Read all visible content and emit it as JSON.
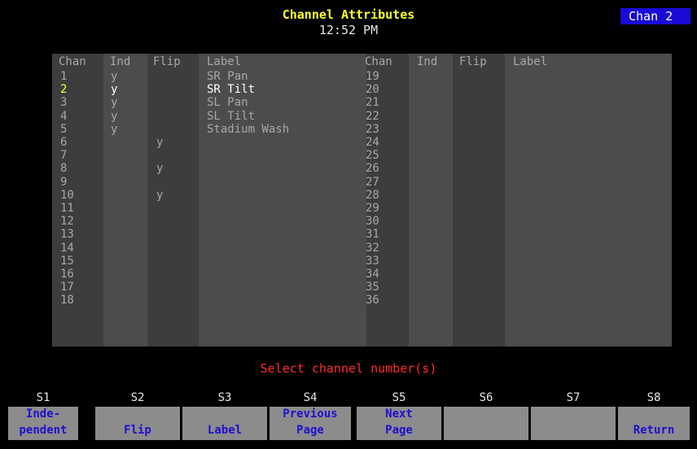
{
  "header": {
    "title": "Channel Attributes",
    "time": "12:52 PM",
    "channel_badge": "Chan 2"
  },
  "table": {
    "headers": {
      "chan": "Chan",
      "ind": "Ind",
      "flip": "Flip",
      "label": "Label"
    },
    "rows": [
      {
        "chan": "1",
        "ind": "y",
        "flip": "",
        "label": "SR Pan"
      },
      {
        "chan": "2",
        "ind": "y",
        "flip": "",
        "label": "SR Tilt",
        "selected": true
      },
      {
        "chan": "3",
        "ind": "y",
        "flip": "",
        "label": "SL Pan"
      },
      {
        "chan": "4",
        "ind": "y",
        "flip": "",
        "label": "SL Tilt"
      },
      {
        "chan": "5",
        "ind": "y",
        "flip": "",
        "label": "Stadium Wash"
      },
      {
        "chan": "6",
        "ind": "",
        "flip": "y",
        "label": ""
      },
      {
        "chan": "7",
        "ind": "",
        "flip": "",
        "label": ""
      },
      {
        "chan": "8",
        "ind": "",
        "flip": "y",
        "label": ""
      },
      {
        "chan": "9",
        "ind": "",
        "flip": "",
        "label": ""
      },
      {
        "chan": "10",
        "ind": "",
        "flip": "y",
        "label": ""
      },
      {
        "chan": "11",
        "ind": "",
        "flip": "",
        "label": ""
      },
      {
        "chan": "12",
        "ind": "",
        "flip": "",
        "label": ""
      },
      {
        "chan": "13",
        "ind": "",
        "flip": "",
        "label": ""
      },
      {
        "chan": "14",
        "ind": "",
        "flip": "",
        "label": ""
      },
      {
        "chan": "15",
        "ind": "",
        "flip": "",
        "label": ""
      },
      {
        "chan": "16",
        "ind": "",
        "flip": "",
        "label": ""
      },
      {
        "chan": "17",
        "ind": "",
        "flip": "",
        "label": ""
      },
      {
        "chan": "18",
        "ind": "",
        "flip": "",
        "label": ""
      },
      {
        "chan": "19",
        "ind": "",
        "flip": "",
        "label": ""
      },
      {
        "chan": "20",
        "ind": "",
        "flip": "",
        "label": ""
      },
      {
        "chan": "21",
        "ind": "",
        "flip": "",
        "label": ""
      },
      {
        "chan": "22",
        "ind": "",
        "flip": "",
        "label": ""
      },
      {
        "chan": "23",
        "ind": "",
        "flip": "",
        "label": ""
      },
      {
        "chan": "24",
        "ind": "",
        "flip": "",
        "label": ""
      },
      {
        "chan": "25",
        "ind": "",
        "flip": "",
        "label": ""
      },
      {
        "chan": "26",
        "ind": "",
        "flip": "",
        "label": ""
      },
      {
        "chan": "27",
        "ind": "",
        "flip": "",
        "label": ""
      },
      {
        "chan": "28",
        "ind": "",
        "flip": "",
        "label": ""
      },
      {
        "chan": "29",
        "ind": "",
        "flip": "",
        "label": ""
      },
      {
        "chan": "30",
        "ind": "",
        "flip": "",
        "label": ""
      },
      {
        "chan": "31",
        "ind": "",
        "flip": "",
        "label": ""
      },
      {
        "chan": "32",
        "ind": "",
        "flip": "",
        "label": ""
      },
      {
        "chan": "33",
        "ind": "",
        "flip": "",
        "label": ""
      },
      {
        "chan": "34",
        "ind": "",
        "flip": "",
        "label": ""
      },
      {
        "chan": "35",
        "ind": "",
        "flip": "",
        "label": ""
      },
      {
        "chan": "36",
        "ind": "",
        "flip": "",
        "label": ""
      }
    ]
  },
  "prompt": "Select channel number(s)",
  "softkeys": [
    {
      "num": "S1",
      "line1": "Inde-",
      "line2": "pendent"
    },
    {
      "num": "S2",
      "line1": "",
      "line2": "Flip"
    },
    {
      "num": "S3",
      "line1": "",
      "line2": "Label"
    },
    {
      "num": "S4",
      "line1": "Previous",
      "line2": "Page"
    },
    {
      "num": "S5",
      "line1": "Next",
      "line2": "Page"
    },
    {
      "num": "S6",
      "line1": "",
      "line2": ""
    },
    {
      "num": "S7",
      "line1": "",
      "line2": ""
    },
    {
      "num": "S8",
      "line1": "",
      "line2": "Return"
    }
  ],
  "colors": {
    "background": "#000000",
    "title": "#ffff33",
    "badge": "#1a0ad6",
    "prompt": "#ff2a2a",
    "softkey_bg": "#8c8c8c",
    "softkey_text": "#1f0fd0"
  }
}
